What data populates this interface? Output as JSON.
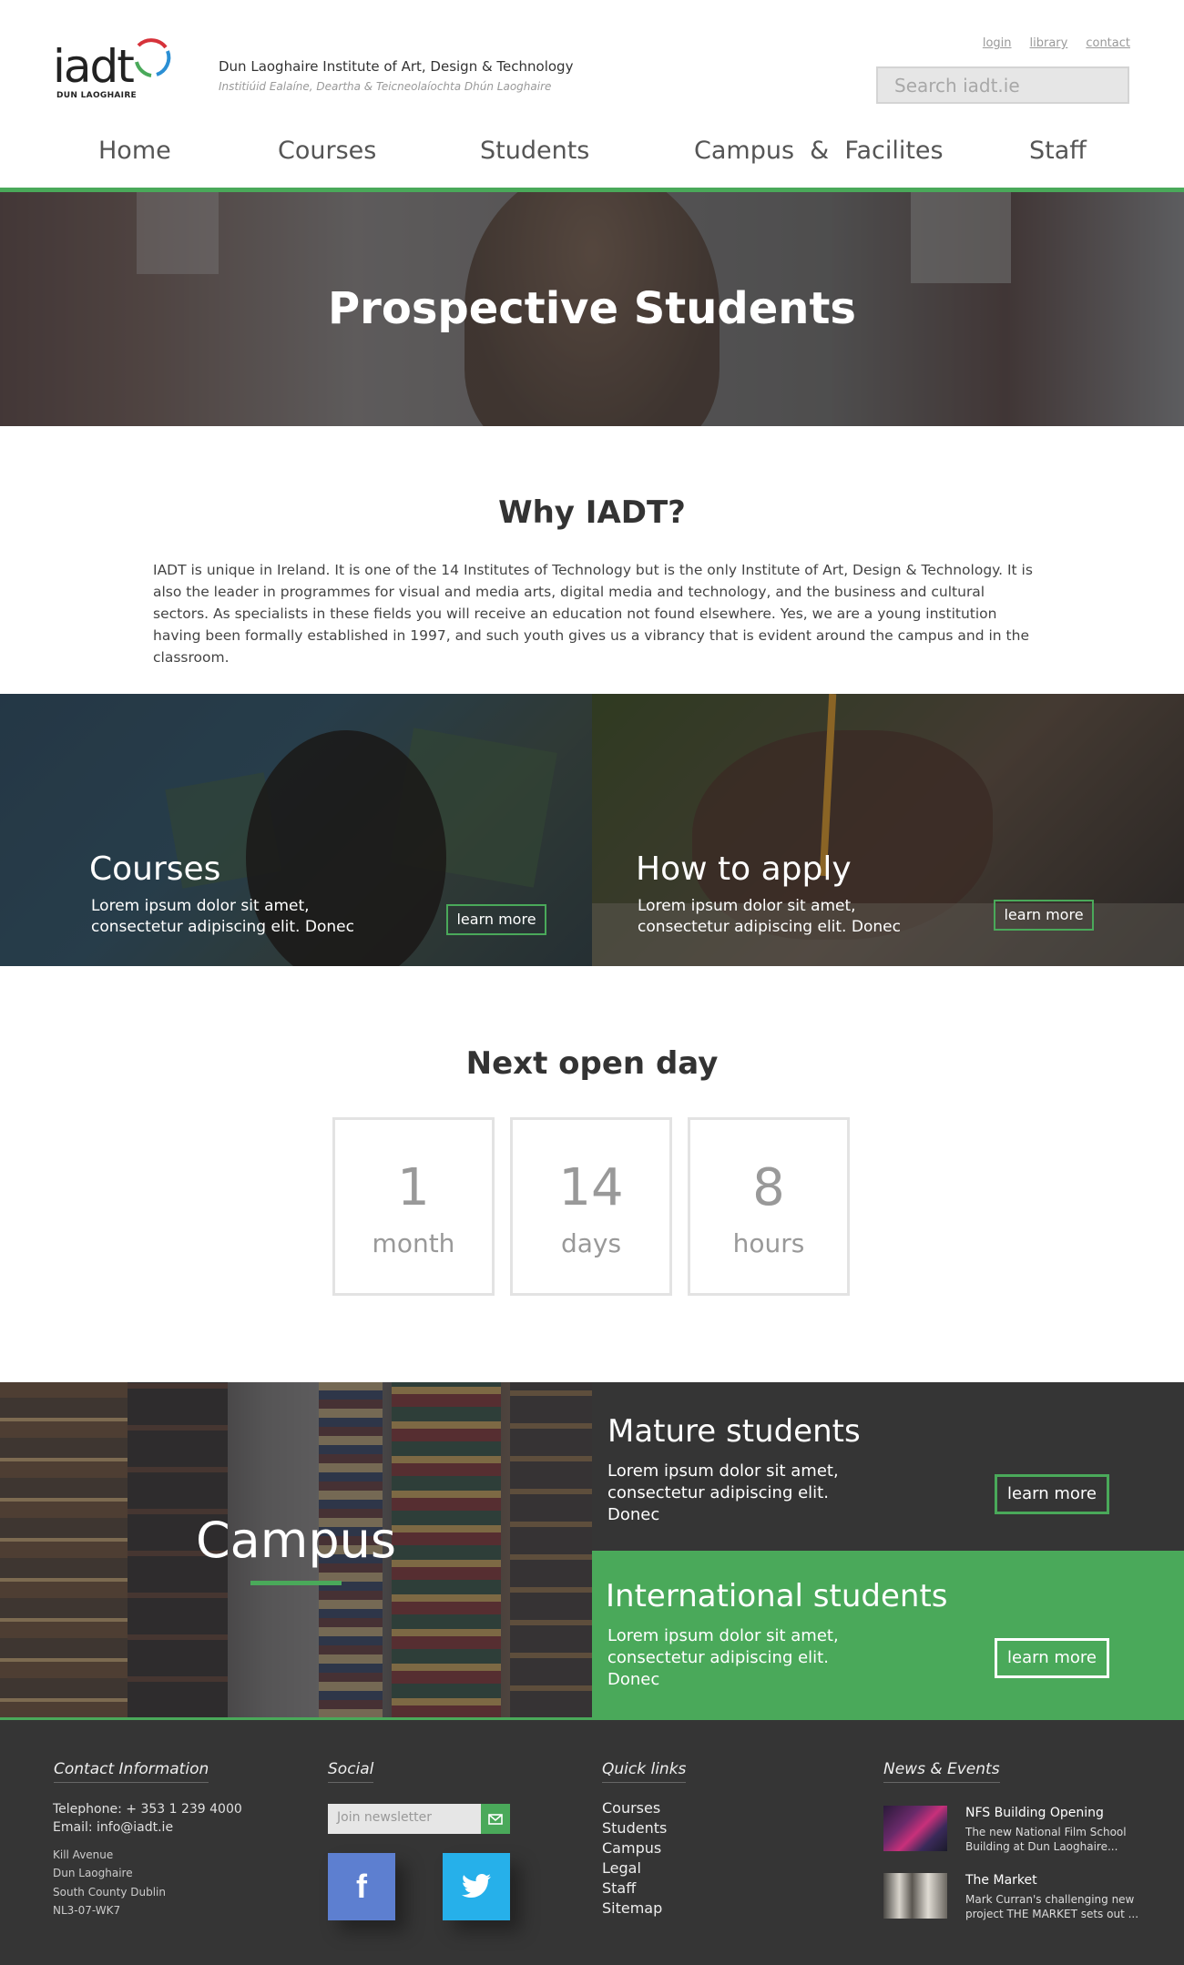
{
  "header": {
    "logo_word": "iadt",
    "logo_sub": "DUN LAOGHAIRE",
    "institute_name": "Dun Laoghaire Institute of Art, Design & Technology",
    "institute_irish": "Institiúid Ealaíne, Deartha & Teicneolaíochta Dhún Laoghaire",
    "top_links": [
      "login",
      "library",
      "contact"
    ],
    "search_placeholder": "Search iadt.ie"
  },
  "nav": [
    "Home",
    "Courses",
    "Students",
    "Campus  &  Facilites",
    "Staff"
  ],
  "hero": {
    "title": "Prospective Students"
  },
  "why": {
    "title": "Why IADT?",
    "text": "IADT is unique in Ireland. It is one of the 14 Institutes of Technology but is the only Institute of Art, Design & Technology. It is also the leader in programmes for visual and media arts, digital media and technology, and the business and cultural sectors. As specialists in these fields you will receive an education not found elsewhere. Yes, we are a young institution having been formally established in 1997, and such youth gives us a vibrancy that is evident around the campus and in the classroom."
  },
  "tiles": [
    {
      "title": "Courses",
      "text": "Lorem ipsum dolor sit amet, consectetur adipiscing elit. Donec",
      "button": "learn more"
    },
    {
      "title": "How to apply",
      "text": "Lorem ipsum dolor sit amet, consectetur adipiscing elit. Donec",
      "button": "learn more"
    }
  ],
  "open_day": {
    "title": "Next open day",
    "counters": [
      {
        "value": "1",
        "unit": "month"
      },
      {
        "value": "14",
        "unit": "days"
      },
      {
        "value": "8",
        "unit": "hours"
      }
    ]
  },
  "campus": {
    "title": "Campus"
  },
  "mature": {
    "title": "Mature students",
    "text": "Lorem ipsum dolor sit amet, consectetur adipiscing elit. Donec",
    "button": "learn more"
  },
  "international": {
    "title": "International students",
    "text": "Lorem ipsum dolor sit amet, consectetur adipiscing elit. Donec",
    "button": "learn more"
  },
  "footer": {
    "contact_heading": "Contact Information",
    "telephone": "Telephone: + 353 1 239 4000",
    "email": "Email:  info@iadt.ie",
    "address": [
      "Kill Avenue",
      "Dun Laoghaire",
      "South County Dublin",
      "NL3-07-WK7"
    ],
    "social_heading": "Social",
    "newsletter_placeholder": "Join newsletter",
    "quicklinks_heading": "Quick links",
    "quicklinks": [
      "Courses",
      "Students",
      "Campus",
      "Legal",
      "Staff",
      "Sitemap"
    ],
    "news_heading": "News & Events",
    "news": [
      {
        "title": "NFS Building Opening",
        "desc": "The new National Film School Building at Dun Laoghaire..."
      },
      {
        "title": "The Market",
        "desc": "Mark Curran's challenging new project THE MARKET sets out ..."
      }
    ]
  },
  "colors": {
    "accent": "#4aa95a",
    "dark": "#353535",
    "facebook": "#5d7fd0",
    "twitter": "#26b0ea"
  },
  "icons": [
    "envelope-icon",
    "facebook-icon",
    "twitter-icon"
  ]
}
